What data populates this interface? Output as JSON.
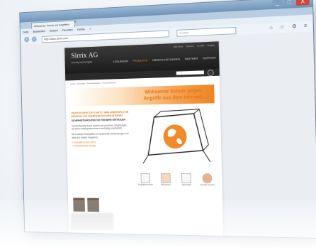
{
  "browser": {
    "tab_title": "Wirksamer Schutz vor Angriffen",
    "tab_new_glyph": "+",
    "menu": [
      "Datei",
      "Bearbeiten",
      "Ansicht",
      "Favoriten",
      "Extras",
      "?"
    ],
    "address": "http://www.sirrix.com/",
    "search_placeholder": "Suchen",
    "win_controls": {
      "min": "_",
      "max": "□",
      "close": "X"
    },
    "toolbar_glyphs": "⌂ ☆ ⚙ ≡"
  },
  "site": {
    "brand": "Sirrix AG",
    "tagline": "security technologies",
    "util_nav": [
      "Über Sirrix",
      "Karriere",
      "Kontakt",
      "English"
    ],
    "main_nav": [
      {
        "label": "Lösungen",
        "active": false
      },
      {
        "label": "Produkte",
        "active": true
      },
      {
        "label": "Dienstleistungen",
        "active": false
      },
      {
        "label": "Partner",
        "active": false
      },
      {
        "label": "Support",
        "active": false
      }
    ],
    "search_icon": "search-icon",
    "breadcrumb": "Home › Produkte › TrustedDesktop › TrustedDesktop",
    "banner": {
      "line1": "Wirksamer Schutz gegen",
      "line2": "Angriffe aus dem Internet!"
    },
    "lead": "Trusted Desktop schützt Ihre Arbeitsplätze wirksam vor Angriffen aus dem Internet",
    "sub": "Sicherheitsarchitektur für mehr Vertrauen",
    "paras": [
      "Trusted Desktop trennt sichere und unsichere Umgebungen auf einem Arbeitsplatzrechner zuverlässig voneinander.",
      "Die Lösung ist kompatibel zu bestehenden Anwendungen und lässt sich einfach integrieren."
    ],
    "links": [
      "» Produktbroschüre (PDF)",
      "» TrustedDesktop Anfrage"
    ],
    "docs": [
      "Produktbroschüre",
      "Whitepaper",
      "Datenblatt",
      "Kontakt Vertrieb"
    ]
  },
  "colors": {
    "accent": "#e4781a",
    "header": "#222222"
  }
}
